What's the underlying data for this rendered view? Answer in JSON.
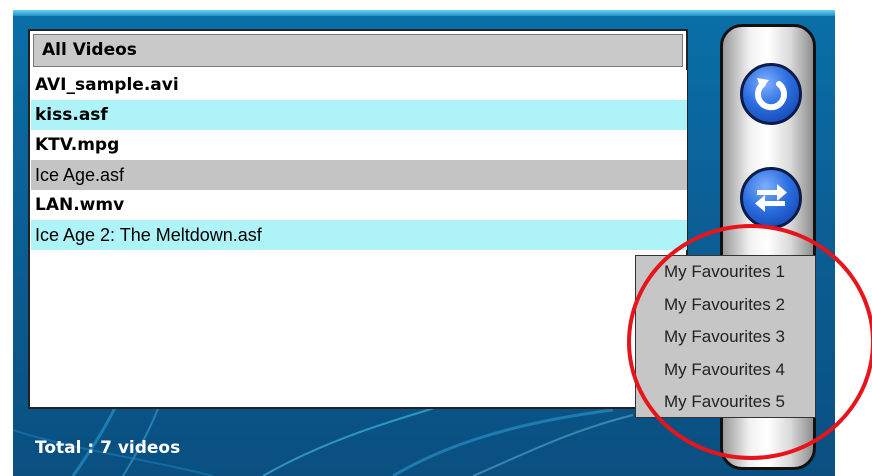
{
  "list": {
    "header": "All Videos",
    "items": [
      {
        "label": "AVI_sample.avi"
      },
      {
        "label": "kiss.asf"
      },
      {
        "label": "KTV.mpg"
      },
      {
        "label": "Ice Age.asf"
      },
      {
        "label": "LAN.wmv"
      },
      {
        "label": "Ice Age 2: The Meltdown.asf"
      }
    ]
  },
  "footer": {
    "total": "Total : 7 videos"
  },
  "sidebar": {
    "buttons": [
      {
        "icon": "refresh-icon"
      },
      {
        "icon": "swap-icon"
      }
    ]
  },
  "popup": {
    "items": [
      {
        "label": "My Favourites 1"
      },
      {
        "label": "My Favourites 2"
      },
      {
        "label": "My Favourites 3"
      },
      {
        "label": "My Favourites 4"
      },
      {
        "label": "My Favourites 5"
      }
    ]
  },
  "colors": {
    "background": "#0b5f95",
    "row_highlight": "#aef3f7",
    "row_selected": "#c4c4c4",
    "annotation_ring": "#e8141b"
  }
}
